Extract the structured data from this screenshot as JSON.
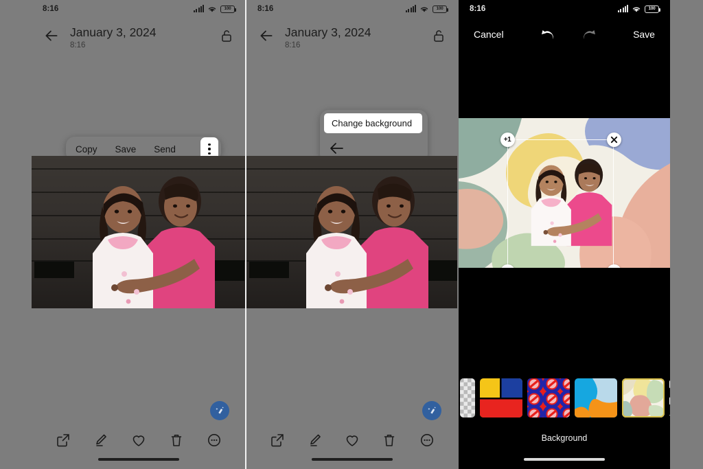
{
  "meta": {
    "scene": "android-photo-viewer-change-background-flow",
    "panel_count": 3,
    "background_color": "#7d7d7d"
  },
  "status_bar": {
    "time": "8:16",
    "battery_text": "100",
    "icons": [
      "signal-icon",
      "wifi-icon",
      "battery-icon"
    ]
  },
  "panel1": {
    "app_bar": {
      "back_icon": "back-arrow-icon",
      "title": "January 3, 2024",
      "subtitle": "8:16",
      "lock_icon": "unlocked-padlock-icon"
    },
    "context_menu": {
      "items": [
        "Copy",
        "Save",
        "Send"
      ],
      "overflow_icon": "kebab-three-dots-icon",
      "overflow_highlighted": true
    },
    "fab": {
      "icon": "magic-eraser-icon",
      "color": "#31609f"
    },
    "bottom_bar": {
      "icons": [
        "share-icon",
        "edit-pencil-icon",
        "favorite-heart-icon",
        "delete-trash-icon",
        "more-circle-icon"
      ]
    }
  },
  "panel2": {
    "app_bar": {
      "back_icon": "back-arrow-icon",
      "title": "January 3, 2024",
      "subtitle": "8:16",
      "lock_icon": "unlocked-padlock-icon"
    },
    "dropdown": {
      "highlighted_item": "Change background",
      "back_icon": "back-arrow-icon"
    },
    "fab": {
      "icon": "magic-eraser-icon",
      "color": "#31609f"
    },
    "bottom_bar": {
      "icons": [
        "share-icon",
        "edit-pencil-icon",
        "favorite-heart-icon",
        "delete-trash-icon",
        "more-circle-icon"
      ]
    }
  },
  "panel3": {
    "edit_bar": {
      "cancel_label": "Cancel",
      "undo_icon": "undo-arrow-icon",
      "undo_enabled": true,
      "redo_icon": "redo-arrow-icon",
      "redo_enabled": false,
      "save_label": "Save"
    },
    "selection": {
      "badge_label": "+1",
      "handles": [
        {
          "position": "top-left",
          "name": "add-layer-badge",
          "label": "+1"
        },
        {
          "position": "top-right",
          "name": "close-x-icon",
          "label": ""
        },
        {
          "position": "bottom-left",
          "name": "flip-horizontal-icon",
          "label": ""
        },
        {
          "position": "bottom-right",
          "name": "drag-hand-icon",
          "label": ""
        }
      ]
    },
    "backgrounds": [
      {
        "name": "checkerboard-transparent",
        "selected": false,
        "partial": "left"
      },
      {
        "name": "mondrian-blocks",
        "selected": false
      },
      {
        "name": "red-blue-circles",
        "selected": false
      },
      {
        "name": "blue-orange-abstract",
        "selected": false
      },
      {
        "name": "pastel-organic-shapes",
        "selected": true
      },
      {
        "name": "diagonal-stripes",
        "selected": false,
        "partial": "right"
      }
    ],
    "footer_label": "Background",
    "selected_accent": "#d9c04a"
  }
}
